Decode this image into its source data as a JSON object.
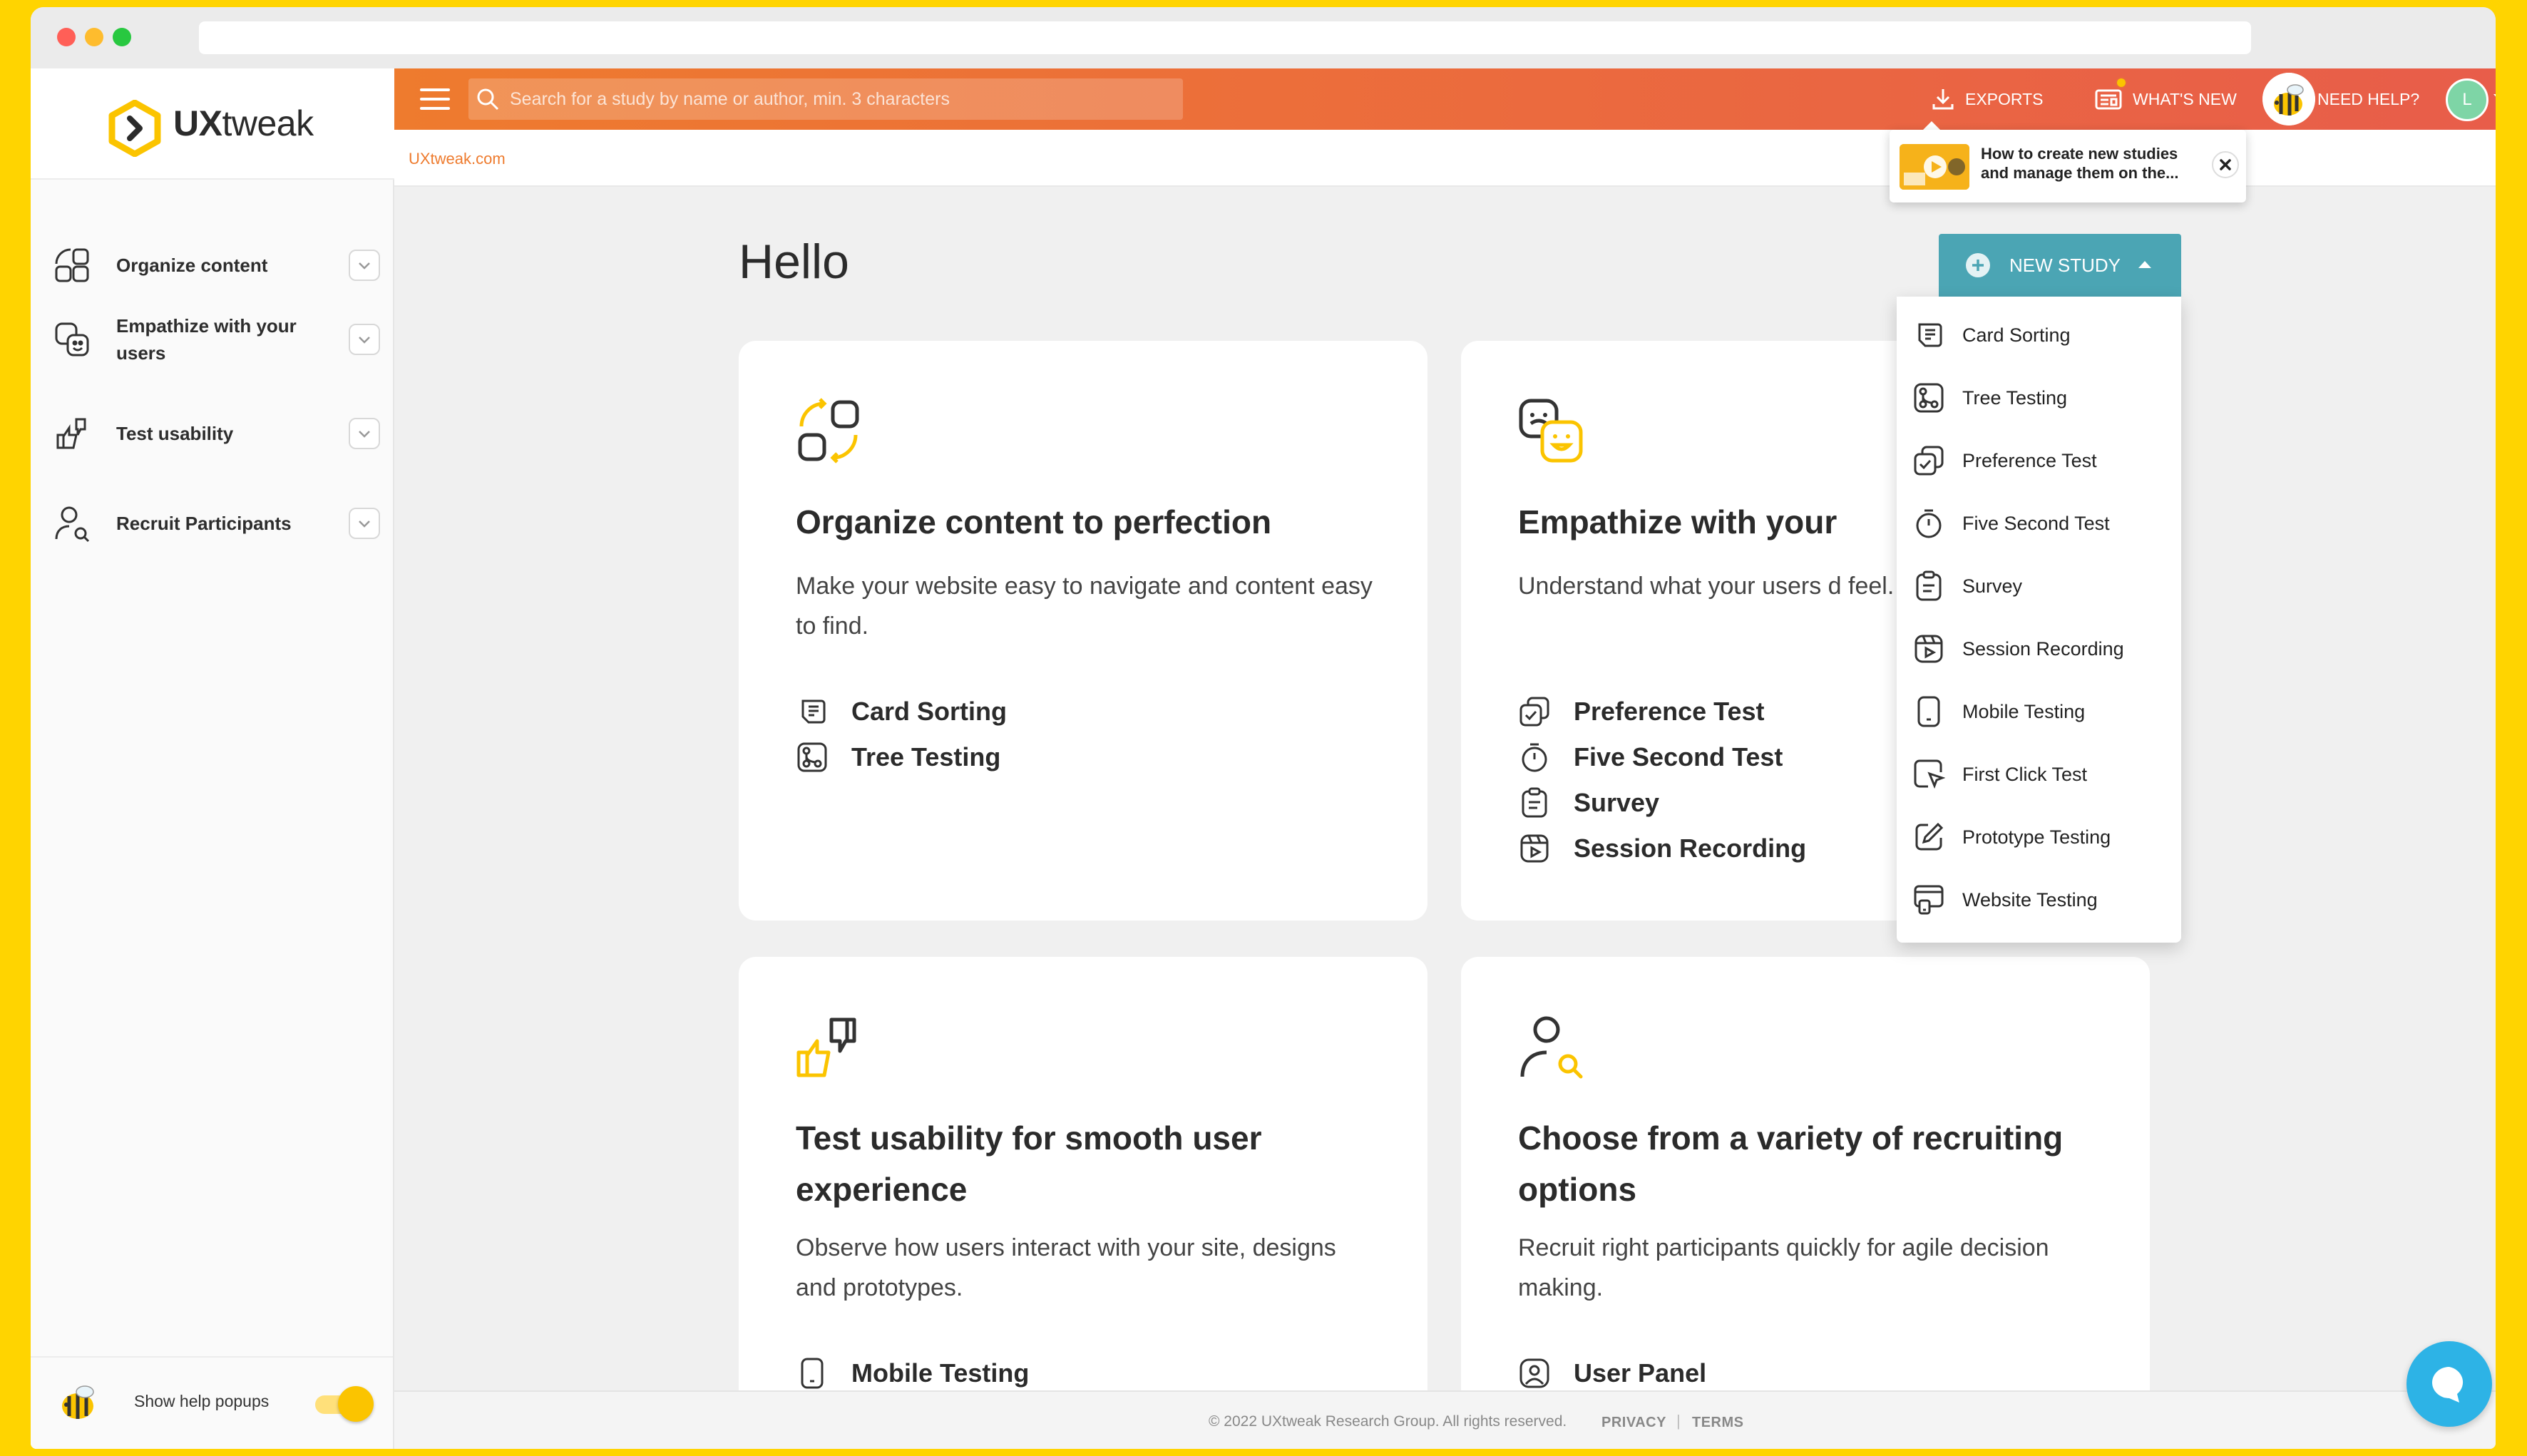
{
  "browser": {
    "url": ""
  },
  "brand": {
    "name_bold": "UX",
    "name_rest": "tweak"
  },
  "sidebar": {
    "items": [
      {
        "label": "Organize content"
      },
      {
        "label": "Empathize with your users"
      },
      {
        "label": "Test usability"
      },
      {
        "label": "Recruit Participants"
      }
    ],
    "footer": {
      "help_label": "Show help popups",
      "help_popups_enabled": true
    }
  },
  "topbar": {
    "search_placeholder": "Search for a study by name or author, min. 3 characters",
    "exports": "EXPORTS",
    "whats_new": "WHAT'S NEW",
    "need_help": "NEED HELP?",
    "user_initial": "L"
  },
  "breadcrumb": "UXtweak.com",
  "tooltip": {
    "text": "How to create new studies and manage them on the..."
  },
  "main": {
    "greeting": "Hello",
    "new_study_label": "NEW STUDY",
    "cards": [
      {
        "title": "Organize content to perfection",
        "description": "Make your website easy to navigate and content easy to find.",
        "links": [
          "Card Sorting",
          "Tree Testing"
        ]
      },
      {
        "title": "Empathize with your",
        "description": "Understand what your users d feel.",
        "links": [
          "Preference Test",
          "Five Second Test",
          "Survey",
          "Session Recording"
        ]
      },
      {
        "title": "Test usability for smooth user experience",
        "description": "Observe how users interact with your site, designs and prototypes.",
        "links": [
          "Mobile Testing"
        ]
      },
      {
        "title": "Choose from a variety of recruiting options",
        "description": "Recruit right participants quickly for agile decision making.",
        "links": [
          "User Panel"
        ]
      }
    ],
    "dropdown": [
      "Card Sorting",
      "Tree Testing",
      "Preference Test",
      "Five Second Test",
      "Survey",
      "Session Recording",
      "Mobile Testing",
      "First Click Test",
      "Prototype Testing",
      "Website Testing"
    ]
  },
  "footer": {
    "copyright": "© 2022 UXtweak Research Group. All rights reserved.",
    "privacy": "PRIVACY",
    "separator": "|",
    "terms": "TERMS"
  },
  "colors": {
    "accent_orange": "#EE7B2E",
    "brand_yellow": "#FBC400",
    "button_teal": "#4BA5B4",
    "chat_blue": "#2DB3E6",
    "page_bg": "#FFD400"
  }
}
